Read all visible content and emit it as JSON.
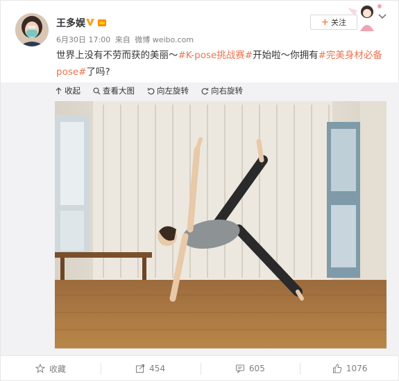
{
  "user": {
    "name": "王多娱",
    "date": "6月30日 17:00",
    "source_prefix": "来自",
    "source": "微博 weibo.com"
  },
  "follow": {
    "label": "关注"
  },
  "post": {
    "parts": [
      "世界上没有不劳而获的美丽～",
      "#K-pose挑战赛#",
      "开始啦～你拥有",
      "#完美身材必备pose#",
      "了吗?"
    ]
  },
  "toolbar": {
    "collapse": "收起",
    "view_large": "查看大图",
    "rotate_left": "向左旋转",
    "rotate_right": "向右旋转"
  },
  "footer": {
    "favorite": "收藏",
    "repost": "454",
    "comment": "605",
    "like": "1076"
  },
  "colors": {
    "accent": "#ff8140",
    "tag": "#eb7350",
    "media_bg": "#f2f2f5"
  }
}
